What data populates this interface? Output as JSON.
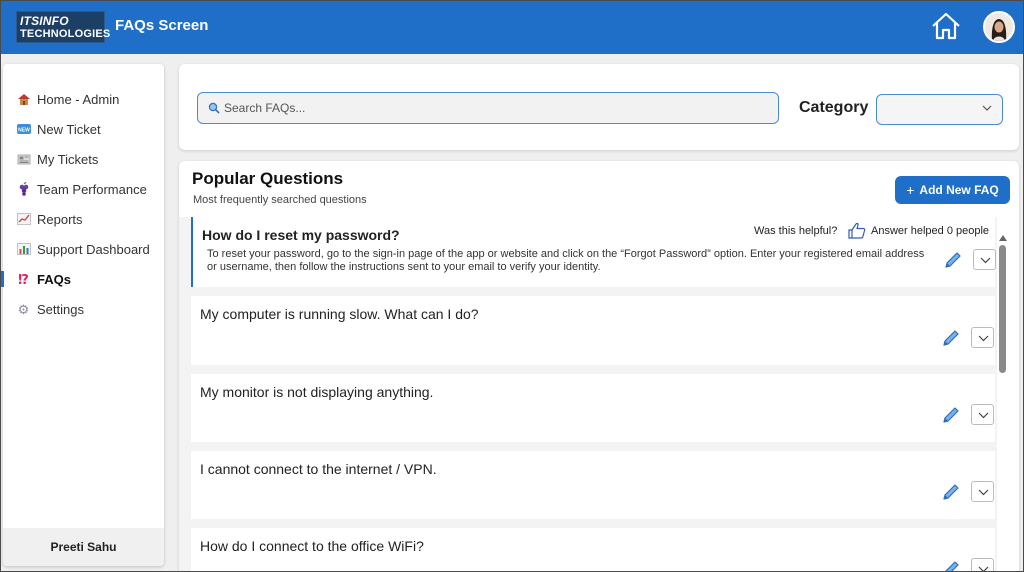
{
  "header": {
    "logo_line1": "ITSINFO",
    "logo_line2": "TECHNOLOGIES",
    "title": "FAQs Screen"
  },
  "sidebar": {
    "items": [
      {
        "label": "Home - Admin",
        "icon": "house-icon"
      },
      {
        "label": "New Ticket",
        "icon": "new-badge-icon"
      },
      {
        "label": "My Tickets",
        "icon": "newspaper-icon"
      },
      {
        "label": "Team Performance",
        "icon": "grapes-icon"
      },
      {
        "label": "Reports",
        "icon": "line-chart-icon"
      },
      {
        "label": "Support Dashboard",
        "icon": "bar-chart-icon"
      },
      {
        "label": "FAQs",
        "icon": "interrobang-icon",
        "active": true
      },
      {
        "label": "Settings",
        "icon": "gear-icon"
      }
    ],
    "user_name": "Preeti Sahu"
  },
  "search": {
    "placeholder": "Search FAQs...",
    "value": ""
  },
  "category": {
    "label": "Category",
    "selected": ""
  },
  "faq_section": {
    "title": "Popular Questions",
    "subtitle": "Most frequently searched questions",
    "add_button": "Add New FAQ",
    "helpful_label": "Was this helpful?",
    "helped_text": "Answer helped 0 people",
    "items": [
      {
        "question": "How do I reset my password?",
        "answer": "To reset your password, go to the sign-in page of the app or website and click on the “Forgot Password” option. Enter your registered email address or username, then follow the instructions sent to your email to verify your identity."
      },
      {
        "question": "My computer is running slow. What can I do?"
      },
      {
        "question": "My monitor is not displaying anything."
      },
      {
        "question": "I cannot connect to the internet / VPN."
      },
      {
        "question": "How do I connect to the office WiFi?"
      }
    ]
  },
  "colors": {
    "header": "#1f6fc8",
    "accent": "#1f6fc8",
    "edit_icon": "#2f7fd8"
  }
}
